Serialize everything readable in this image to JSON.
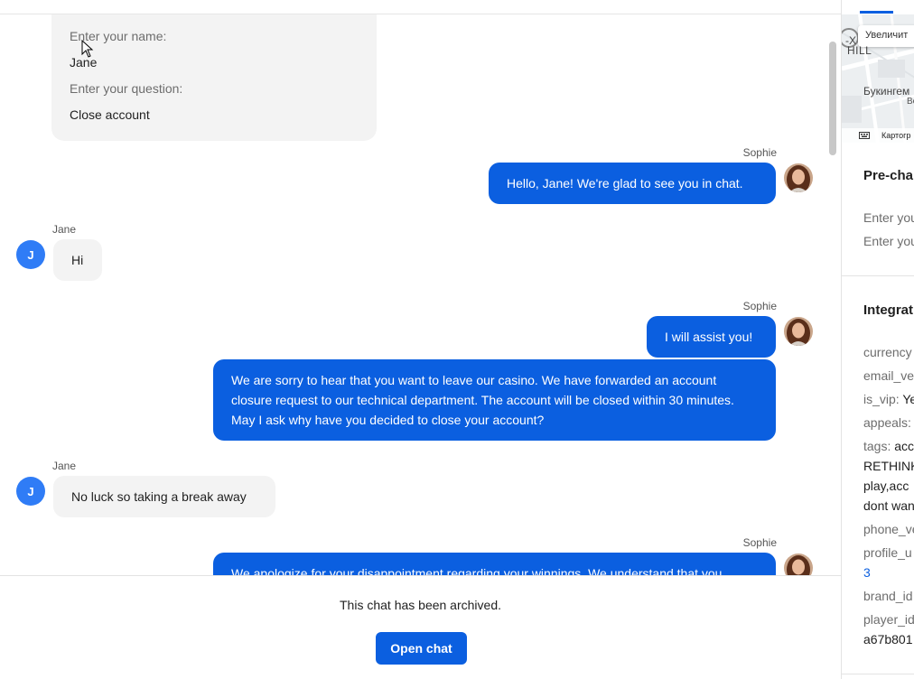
{
  "prechat_card": {
    "name_label": "Enter your name:",
    "name_value": "Jane",
    "question_label": "Enter your question:",
    "question_value": "Close account"
  },
  "messages": [
    {
      "sender": "Sophie",
      "text": "Hello, Jane! We're glad to see you in chat."
    },
    {
      "sender": "Jane",
      "text": "Hi"
    },
    {
      "sender": "Sophie",
      "text": "I will assist you!"
    },
    {
      "sender": "Sophie",
      "text": "We are sorry to hear that you want to leave our casino. We have forwarded an account closure request to our technical department. The account will be closed within 30 minutes. May I ask why have you decided to close your account?"
    },
    {
      "sender": "Jane",
      "text": "No luck so taking a break away"
    },
    {
      "sender": "Sophie",
      "text": "We apologize for your disappointment regarding your winnings. We understand that you"
    }
  ],
  "avatars": {
    "jane_initial": "J"
  },
  "footer": {
    "archived_text": "This chat has been archived.",
    "open_chat_label": "Open chat"
  },
  "side_panel": {
    "map": {
      "enlarge_button": "Увеличит",
      "label_hill": "HILL",
      "label_partial": "-Х",
      "label_buckingham": "Букингем",
      "label_small": "Ве",
      "footer_text": "Картогр"
    },
    "prechat_title": "Pre-cha",
    "prechat_rows": [
      "Enter you",
      "Enter you"
    ],
    "integrations_title": "Integrat",
    "integration_rows": [
      {
        "key": "currency",
        "value": ""
      },
      {
        "key": "email_ve",
        "value": ""
      },
      {
        "key": "is_vip:",
        "value": "Ye"
      },
      {
        "key": "appeals:",
        "value": ""
      },
      {
        "key": "tags:",
        "value": "acc"
      },
      {
        "key": "",
        "value": "RETHINK"
      },
      {
        "key": "",
        "value": "play,acc"
      },
      {
        "key": "",
        "value": "dont wan"
      },
      {
        "key": "phone_ve",
        "value": ""
      },
      {
        "key": "profile_u",
        "value": ""
      },
      {
        "key": "",
        "value": "3"
      },
      {
        "key": "brand_id",
        "value": ""
      },
      {
        "key": "player_id",
        "value": ""
      },
      {
        "key": "",
        "value": "a67b801"
      }
    ]
  },
  "colors": {
    "accent": "#0b5fe0",
    "incoming_bubble": "#f3f3f3",
    "avatar_j": "#2f7cf6"
  }
}
